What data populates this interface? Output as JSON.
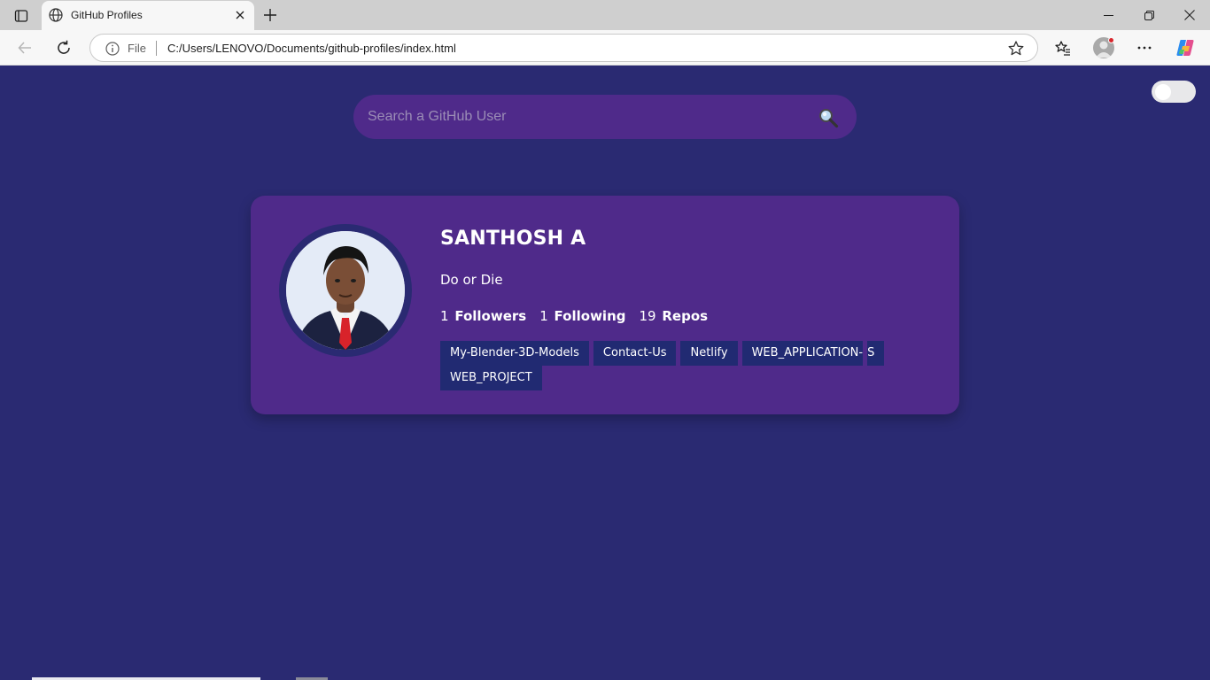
{
  "browser": {
    "tab_title": "GitHub Profiles",
    "address_scheme_label": "File",
    "url": "C:/Users/LENOVO/Documents/github-profiles/index.html"
  },
  "page": {
    "search": {
      "placeholder": "Search a GitHub User",
      "value": ""
    },
    "theme_toggle": {
      "enabled": false
    },
    "profile": {
      "name": "SANTHOSH A",
      "bio": "Do or Die",
      "followers_count": "1",
      "followers_label": "Followers",
      "following_count": "1",
      "following_label": "Following",
      "repos_count": "19",
      "repos_label": "Repos",
      "repositories": [
        "My-Blender-3D-Models",
        "Contact-Us",
        "Netlify",
        "WEB_APPLICATION-",
        "S",
        "WEB_PROJECT"
      ]
    }
  },
  "colors": {
    "page_background": "#2a2a72",
    "card_background": "#4f2a8a",
    "repo_chip": "#212a72",
    "text": "#ffffff"
  }
}
